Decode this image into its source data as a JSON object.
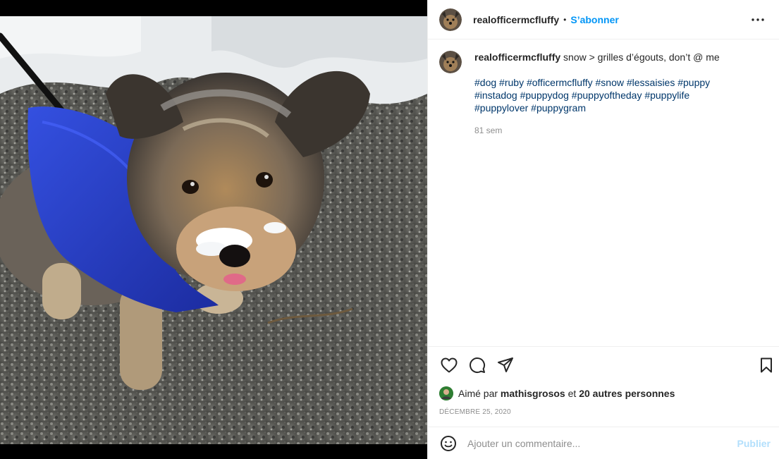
{
  "post": {
    "username": "realofficermcfluffy",
    "separator": "•",
    "follow_label": "S’abonner",
    "caption_text": " snow > grilles d’égouts, don’t @ me",
    "hashtags": [
      "#dog",
      "#ruby",
      "#officermcfluffy",
      "#snow",
      "#lessaisies",
      "#puppy",
      "#instadog",
      "#puppydog",
      "#puppyoftheday",
      "#puppylife",
      "#puppylover",
      "#puppygram"
    ],
    "age": "81 sem"
  },
  "likes": {
    "prefix": "Aimé par ",
    "liker": "mathisgrosos",
    "conjunction": " et ",
    "others": "20 autres personnes"
  },
  "date": "DÉCEMBRE 25, 2020",
  "comment_box": {
    "placeholder": "Ajouter un commentaire...",
    "submit_label": "Publier"
  },
  "icons": {
    "more": "more-options-icon",
    "like": "heart-icon",
    "comment": "comment-icon",
    "share": "paper-plane-icon",
    "save": "bookmark-icon",
    "emoji": "emoji-icon"
  },
  "colors": {
    "accent": "#0095f6",
    "hashtag": "#00376b",
    "muted": "#8e8e8e",
    "publish_disabled": "#b2dffc",
    "dog_coat": "#2a3fd0"
  }
}
